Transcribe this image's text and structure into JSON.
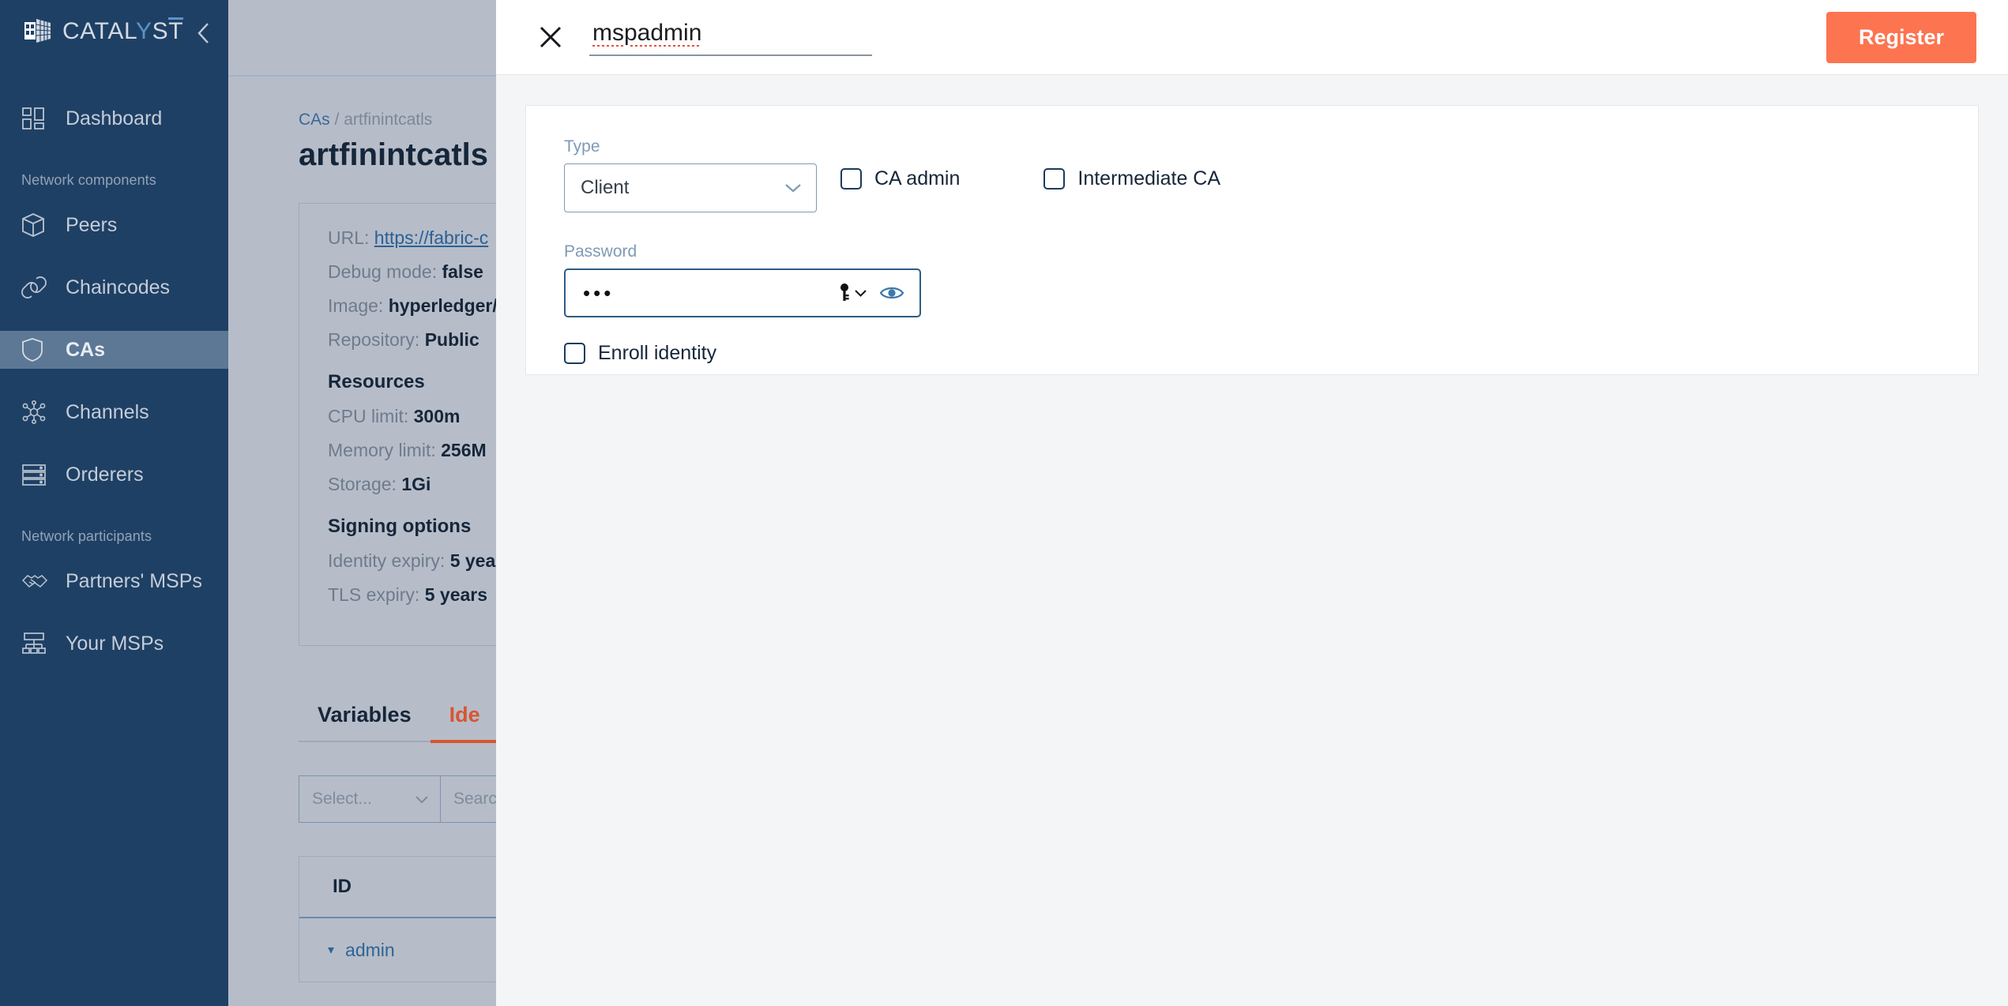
{
  "brand": {
    "name_part1": "CATAL",
    "name_accent": "Y",
    "name_part2": "S",
    "name_bar": "T",
    "logo_icon": "cube-grid-icon",
    "collapse_icon": "chevron-left-icon"
  },
  "sidebar": {
    "items": [
      {
        "label": "Dashboard",
        "icon": "dashboard-grid-icon",
        "active": false
      },
      {
        "label": "Peers",
        "icon": "cube-icon",
        "active": false
      },
      {
        "label": "Chaincodes",
        "icon": "link-chain-icon",
        "active": false
      },
      {
        "label": "CAs",
        "icon": "shield-icon",
        "active": true
      },
      {
        "label": "Channels",
        "icon": "network-nodes-icon",
        "active": false
      },
      {
        "label": "Orderers",
        "icon": "server-stack-icon",
        "active": false
      },
      {
        "label": "Partners' MSPs",
        "icon": "handshake-icon",
        "active": false
      },
      {
        "label": "Your MSPs",
        "icon": "org-chart-icon",
        "active": false
      }
    ],
    "section_labels": {
      "network_components": "Network components",
      "network_participants": "Network participants"
    }
  },
  "page": {
    "breadcrumb_root": "CAs",
    "breadcrumb_sep": "/",
    "breadcrumb_current": "artfinintcatls",
    "title": "artfinintcatls",
    "info": {
      "url_label": "URL:",
      "url_value": "https://fabric-c",
      "debug_label": "Debug mode:",
      "debug_value": "false",
      "image_label": "Image:",
      "image_value": "hyperledger/",
      "repository_label": "Repository:",
      "repository_value": "Public",
      "resources_heading": "Resources",
      "cpu_label": "CPU limit:",
      "cpu_value": "300m",
      "memory_label": "Memory limit:",
      "memory_value": "256M",
      "storage_label": "Storage:",
      "storage_value": "1Gi",
      "signing_heading": "Signing options",
      "identity_expiry_label": "Identity expiry:",
      "identity_expiry_value": "5 yea",
      "tls_expiry_label": "TLS expiry:",
      "tls_expiry_value": "5 years"
    },
    "tabs": [
      {
        "label": "Variables",
        "active": false
      },
      {
        "label": "Ide",
        "active": true
      }
    ],
    "filters": {
      "select_placeholder": "Select...",
      "search_placeholder": "Searc"
    },
    "table": {
      "columns": [
        "ID"
      ],
      "rows": [
        {
          "id": "admin"
        }
      ]
    }
  },
  "modal": {
    "close_icon": "close-x-icon",
    "name_value": "mspadmin",
    "register_label": "Register",
    "form": {
      "type_label": "Type",
      "type_value": "Client",
      "type_chevron_icon": "chevron-down-icon",
      "ca_admin_label": "CA admin",
      "ca_admin_checked": false,
      "intermediate_ca_label": "Intermediate CA",
      "intermediate_ca_checked": false,
      "password_label": "Password",
      "password_masked": "•••",
      "password_manager_icon": "key-icon",
      "password_manager_chevron": "chevron-down-icon",
      "reveal_icon": "eye-icon",
      "enroll_label": "Enroll identity",
      "enroll_checked": false
    }
  },
  "colors": {
    "sidebar_bg": "#1f4065",
    "sidebar_active": "#5c7895",
    "accent_orange": "#fd7450",
    "tab_active": "#d9552f",
    "link_blue": "#2c6094",
    "field_border": "#7e9ab5"
  }
}
